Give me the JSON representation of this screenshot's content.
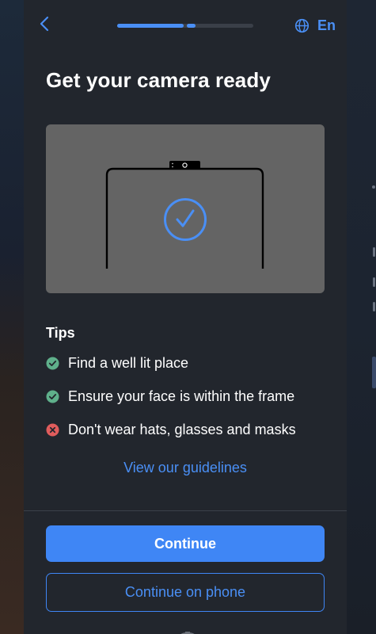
{
  "header": {
    "back_icon": "chevron-left-icon",
    "progress_fraction": 0.58,
    "language_icon": "globe-icon",
    "language_label": "En"
  },
  "main": {
    "title": "Get your camera ready",
    "illustration": {
      "description_icon": "camera-check-icon",
      "accent_color": "#4a8ff5",
      "background_color": "#646464"
    },
    "tips_heading": "Tips",
    "tips": [
      {
        "text": "Find a well lit place",
        "status": "ok",
        "icon": "check-circle-icon",
        "color": "#5fb08b"
      },
      {
        "text": "Ensure your face is within the frame",
        "status": "ok",
        "icon": "check-circle-icon",
        "color": "#5fb08b"
      },
      {
        "text": "Don't wear hats, glasses and masks",
        "status": "bad",
        "icon": "x-circle-icon",
        "color": "#e05c5c"
      }
    ],
    "guidelines_link": "View our guidelines"
  },
  "footer": {
    "continue_label": "Continue",
    "continue_phone_label": "Continue on phone"
  },
  "colors": {
    "panel": "#22262d",
    "accent": "#3f86f5"
  }
}
